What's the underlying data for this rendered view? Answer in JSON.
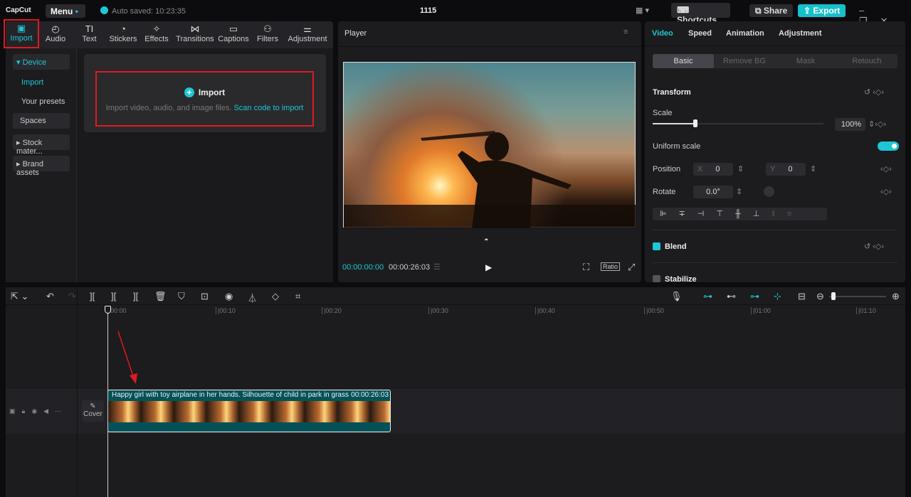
{
  "app": {
    "logo": "CapCut",
    "menu": "Menu",
    "autosave": "Auto saved: 10:23:35",
    "title": "1115",
    "shortcuts": "Shortcuts",
    "share": "Share",
    "export": "Export"
  },
  "tabs": [
    {
      "label": "Import",
      "icon": "▣"
    },
    {
      "label": "Audio",
      "icon": "◴"
    },
    {
      "label": "Text",
      "icon": "TI"
    },
    {
      "label": "Stickers",
      "icon": "◔"
    },
    {
      "label": "Effects",
      "icon": "✧"
    },
    {
      "label": "Transitions",
      "icon": "⋈"
    },
    {
      "label": "Captions",
      "icon": "▭"
    },
    {
      "label": "Filters",
      "icon": "⚇"
    },
    {
      "label": "Adjustment",
      "icon": "⚌"
    }
  ],
  "sidebar": {
    "device": "▾ Device",
    "import": "Import",
    "presets": "Your presets",
    "spaces": "Spaces",
    "stock": "▸ Stock mater...",
    "brand": "▸ Brand assets"
  },
  "importbox": {
    "title": "Import",
    "desc": "Import video, audio, and image files.",
    "link": "Scan code to import"
  },
  "player": {
    "title": "Player",
    "current": "00:00:00:00",
    "total": "00:00:26:03",
    "ratio": "Ratio"
  },
  "right": {
    "tabs": [
      "Video",
      "Speed",
      "Animation",
      "Adjustment"
    ],
    "segments": [
      "Basic",
      "Remove BG",
      "Mask",
      "Retouch"
    ],
    "transform": "Transform",
    "scale_label": "Scale",
    "scale_value": "100%",
    "scale_fraction": 0.25,
    "uniform": "Uniform scale",
    "uniform_on": true,
    "position": "Position",
    "x_label": "X",
    "x": "0",
    "y_label": "Y",
    "y": "0",
    "rotate": "Rotate",
    "rotate_value": "0.0°",
    "blend": "Blend",
    "stabilize": "Stabilize"
  },
  "timeline": {
    "ticks": [
      "00:00",
      "|00:10",
      "|00:20",
      "|00:30",
      "|00:40",
      "|00:50",
      "|01:00",
      "|01:10"
    ],
    "cover": "Cover",
    "clip_title": "Happy girl with toy airplane in her hands. Silhouette of child in park in grass",
    "clip_duration": "00:00:26:03"
  },
  "colors": {
    "accent": "#1fc6d3",
    "highlight": "#e0191f"
  }
}
